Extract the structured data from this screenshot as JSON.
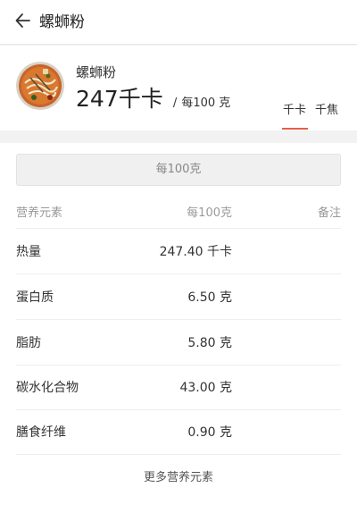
{
  "header": {
    "title": "螺蛳粉"
  },
  "food": {
    "name": "螺蛳粉",
    "calories": "247",
    "calorie_unit": "千卡",
    "separator": "/",
    "per_amount": "每100 克"
  },
  "unit_tabs": {
    "kcal": "千卡",
    "kj": "千焦",
    "selected": "千卡"
  },
  "nutrition": {
    "per_selector": "每100克",
    "columns": {
      "name": "营养元素",
      "amount": "每100克",
      "note": "备注"
    },
    "rows": [
      {
        "name": "热量",
        "value": "247.40 千卡"
      },
      {
        "name": "蛋白质",
        "value": "6.50 克"
      },
      {
        "name": "脂肪",
        "value": "5.80 克"
      },
      {
        "name": "碳水化合物",
        "value": "43.00 克"
      },
      {
        "name": "膳食纤维",
        "value": "0.90 克"
      }
    ],
    "more_label": "更多营养元素"
  },
  "colors": {
    "accent": "#e85c4a",
    "page_bg": "#f2f2f2"
  }
}
